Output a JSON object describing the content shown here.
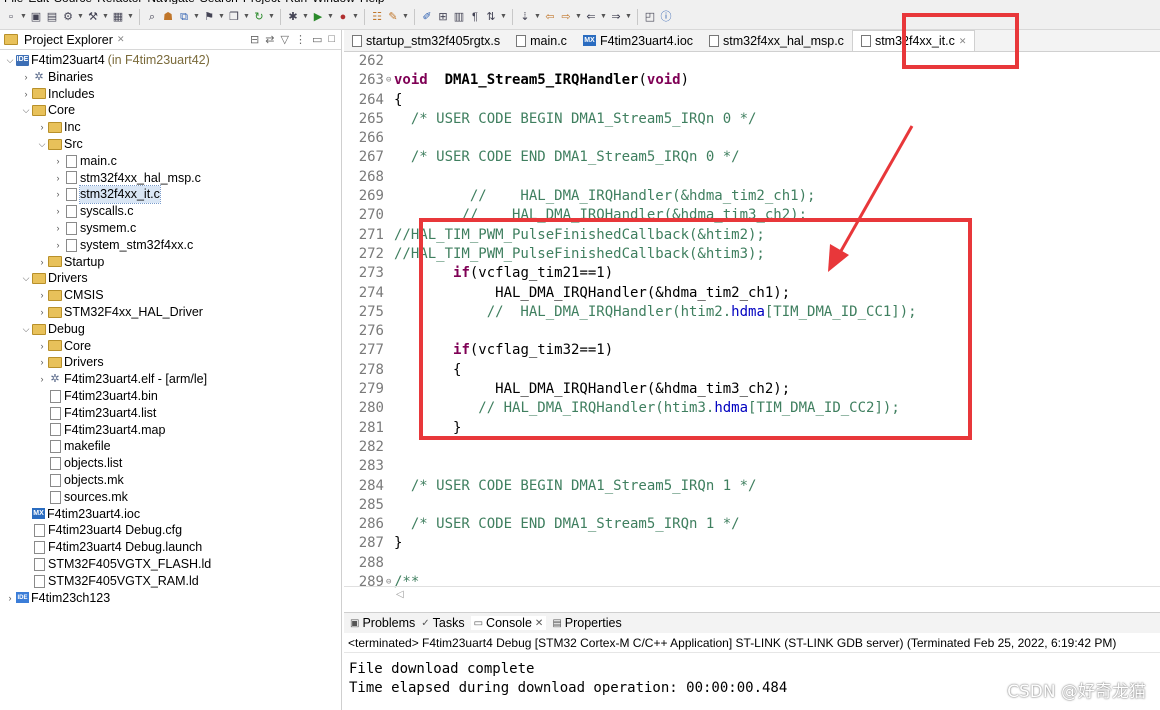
{
  "menubar": [
    "File",
    "Edit",
    "Source",
    "Refactor",
    "Navigate",
    "Search",
    "Project",
    "Run",
    "Window",
    "Help"
  ],
  "explorer": {
    "title": "Project Explorer",
    "tree": [
      {
        "label": "F4tim23uart4",
        "suffix": "(in F4tim23uart42)",
        "icon": "project",
        "depth": 0,
        "expanded": true
      },
      {
        "label": "Binaries",
        "icon": "gear",
        "depth": 1,
        "expanded": false
      },
      {
        "label": "Includes",
        "icon": "folder",
        "depth": 1,
        "expanded": false
      },
      {
        "label": "Core",
        "icon": "folder",
        "depth": 1,
        "expanded": true
      },
      {
        "label": "Inc",
        "icon": "folder",
        "depth": 2,
        "expanded": false
      },
      {
        "label": "Src",
        "icon": "folder",
        "depth": 2,
        "expanded": true
      },
      {
        "label": "main.c",
        "icon": "file",
        "depth": 3,
        "expanded": false
      },
      {
        "label": "stm32f4xx_hal_msp.c",
        "icon": "file",
        "depth": 3,
        "expanded": false
      },
      {
        "label": "stm32f4xx_it.c",
        "icon": "file",
        "depth": 3,
        "expanded": false,
        "selected": true
      },
      {
        "label": "syscalls.c",
        "icon": "file",
        "depth": 3,
        "expanded": false
      },
      {
        "label": "sysmem.c",
        "icon": "file",
        "depth": 3,
        "expanded": false
      },
      {
        "label": "system_stm32f4xx.c",
        "icon": "file",
        "depth": 3,
        "expanded": false
      },
      {
        "label": "Startup",
        "icon": "folder",
        "depth": 2,
        "expanded": false
      },
      {
        "label": "Drivers",
        "icon": "folder",
        "depth": 1,
        "expanded": true
      },
      {
        "label": "CMSIS",
        "icon": "folder",
        "depth": 2,
        "expanded": false
      },
      {
        "label": "STM32F4xx_HAL_Driver",
        "icon": "folder",
        "depth": 2,
        "expanded": false
      },
      {
        "label": "Debug",
        "icon": "folder",
        "depth": 1,
        "expanded": true
      },
      {
        "label": "Core",
        "icon": "folder",
        "depth": 2,
        "expanded": false
      },
      {
        "label": "Drivers",
        "icon": "folder",
        "depth": 2,
        "expanded": false
      },
      {
        "label": "F4tim23uart4.elf - [arm/le]",
        "icon": "gear",
        "depth": 2,
        "expanded": false
      },
      {
        "label": "F4tim23uart4.bin",
        "icon": "file",
        "depth": 2,
        "leaf": true
      },
      {
        "label": "F4tim23uart4.list",
        "icon": "file",
        "depth": 2,
        "leaf": true
      },
      {
        "label": "F4tim23uart4.map",
        "icon": "file",
        "depth": 2,
        "leaf": true
      },
      {
        "label": "makefile",
        "icon": "file",
        "depth": 2,
        "leaf": true
      },
      {
        "label": "objects.list",
        "icon": "file",
        "depth": 2,
        "leaf": true
      },
      {
        "label": "objects.mk",
        "icon": "file",
        "depth": 2,
        "leaf": true
      },
      {
        "label": "sources.mk",
        "icon": "file",
        "depth": 2,
        "leaf": true
      },
      {
        "label": "F4tim23uart4.ioc",
        "icon": "mx",
        "depth": 1,
        "leaf": true
      },
      {
        "label": "F4tim23uart4 Debug.cfg",
        "icon": "file",
        "depth": 1,
        "leaf": true
      },
      {
        "label": "F4tim23uart4 Debug.launch",
        "icon": "file",
        "depth": 1,
        "leaf": true
      },
      {
        "label": "STM32F405VGTX_FLASH.ld",
        "icon": "file",
        "depth": 1,
        "leaf": true
      },
      {
        "label": "STM32F405VGTX_RAM.ld",
        "icon": "file",
        "depth": 1,
        "leaf": true
      },
      {
        "label": "F4tim23ch123",
        "icon": "ide",
        "depth": 0,
        "expanded": false
      }
    ]
  },
  "editor": {
    "tabs": [
      {
        "label": "startup_stm32f405rgtx.s",
        "icon": "file"
      },
      {
        "label": "main.c",
        "icon": "file"
      },
      {
        "label": "F4tim23uart4.ioc",
        "icon": "mx"
      },
      {
        "label": "stm32f4xx_hal_msp.c",
        "icon": "file"
      },
      {
        "label": "stm32f4xx_it.c",
        "icon": "file",
        "active": true
      }
    ],
    "lines": [
      {
        "n": "262",
        "segs": []
      },
      {
        "n": "263",
        "fold": "⊖",
        "segs": [
          [
            "kw",
            "void"
          ],
          [
            "",
            "  "
          ],
          [
            "fn",
            "DMA1_Stream5_IRQHandler"
          ],
          [
            "",
            "("
          ],
          [
            "kw",
            "void"
          ],
          [
            "",
            ")"
          ]
        ]
      },
      {
        "n": "264",
        "segs": [
          [
            "",
            "{"
          ]
        ]
      },
      {
        "n": "265",
        "segs": [
          [
            "",
            "  "
          ],
          [
            "cm",
            "/* USER CODE BEGIN DMA1_Stream5_IRQn 0 */"
          ]
        ]
      },
      {
        "n": "266",
        "segs": []
      },
      {
        "n": "267",
        "segs": [
          [
            "",
            "  "
          ],
          [
            "cm",
            "/* USER CODE END DMA1_Stream5_IRQn 0 */"
          ]
        ]
      },
      {
        "n": "268",
        "segs": []
      },
      {
        "n": "269",
        "segs": [
          [
            "",
            "         "
          ],
          [
            "cm",
            "//    HAL_DMA_IRQHandler(&hdma_tim2_ch1);"
          ]
        ]
      },
      {
        "n": "270",
        "segs": [
          [
            "",
            "        "
          ],
          [
            "cm",
            "//    HAL_DMA_IRQHandler(&hdma_tim3_ch2);"
          ]
        ]
      },
      {
        "n": "271",
        "segs": [
          [
            "cm",
            "//HAL_TIM_PWM_PulseFinishedCallback(&htim2);"
          ]
        ]
      },
      {
        "n": "272",
        "segs": [
          [
            "cm",
            "//HAL_TIM_PWM_PulseFinishedCallback(&htim3);"
          ]
        ]
      },
      {
        "n": "273",
        "segs": [
          [
            "",
            "       "
          ],
          [
            "kw",
            "if"
          ],
          [
            "",
            "(vcflag_tim21==1)"
          ]
        ]
      },
      {
        "n": "274",
        "segs": [
          [
            "",
            "            HAL_DMA_IRQHandler(&hdma_tim2_ch1);"
          ]
        ]
      },
      {
        "n": "275",
        "segs": [
          [
            "",
            "           "
          ],
          [
            "cm",
            "//  HAL_DMA_IRQHandler(htim2."
          ],
          [
            "field",
            "hdma"
          ],
          [
            "cm",
            "[TIM_DMA_ID_CC1]);"
          ]
        ]
      },
      {
        "n": "276",
        "segs": []
      },
      {
        "n": "277",
        "segs": [
          [
            "",
            "       "
          ],
          [
            "kw",
            "if"
          ],
          [
            "",
            "(vcflag_tim32==1)"
          ]
        ]
      },
      {
        "n": "278",
        "segs": [
          [
            "",
            "       {"
          ]
        ]
      },
      {
        "n": "279",
        "segs": [
          [
            "",
            "            HAL_DMA_IRQHandler(&hdma_tim3_ch2);"
          ]
        ]
      },
      {
        "n": "280",
        "segs": [
          [
            "",
            "          "
          ],
          [
            "cm",
            "// HAL_DMA_IRQHandler(htim3."
          ],
          [
            "field",
            "hdma"
          ],
          [
            "cm",
            "[TIM_DMA_ID_CC2]);"
          ]
        ]
      },
      {
        "n": "281",
        "segs": [
          [
            "",
            "       }"
          ]
        ]
      },
      {
        "n": "282",
        "segs": []
      },
      {
        "n": "283",
        "segs": []
      },
      {
        "n": "284",
        "segs": [
          [
            "",
            "  "
          ],
          [
            "cm",
            "/* USER CODE BEGIN DMA1_Stream5_IRQn 1 */"
          ]
        ]
      },
      {
        "n": "285",
        "segs": []
      },
      {
        "n": "286",
        "segs": [
          [
            "",
            "  "
          ],
          [
            "cm",
            "/* USER CODE END DMA1_Stream5_IRQn 1 */"
          ]
        ]
      },
      {
        "n": "287",
        "segs": [
          [
            "",
            "}"
          ]
        ]
      },
      {
        "n": "288",
        "segs": []
      },
      {
        "n": "289",
        "fold": "⊖",
        "segs": [
          [
            "cm",
            "/**"
          ]
        ]
      }
    ]
  },
  "console": {
    "tabs": [
      "Problems",
      "Tasks",
      "Console",
      "Properties"
    ],
    "status": "<terminated> F4tim23uart4 Debug [STM32 Cortex-M C/C++ Application] ST-LINK (ST-LINK GDB server) (Terminated Feb 25, 2022, 6:19:42 PM)",
    "output": [
      "File download complete",
      "Time elapsed during download operation: 00:00:00.484"
    ]
  },
  "watermark": "CSDN @好奇龙猫",
  "colors": {
    "annotation_red": "#e8373a",
    "keyword": "#7f0055",
    "comment": "#3f7f5f"
  }
}
